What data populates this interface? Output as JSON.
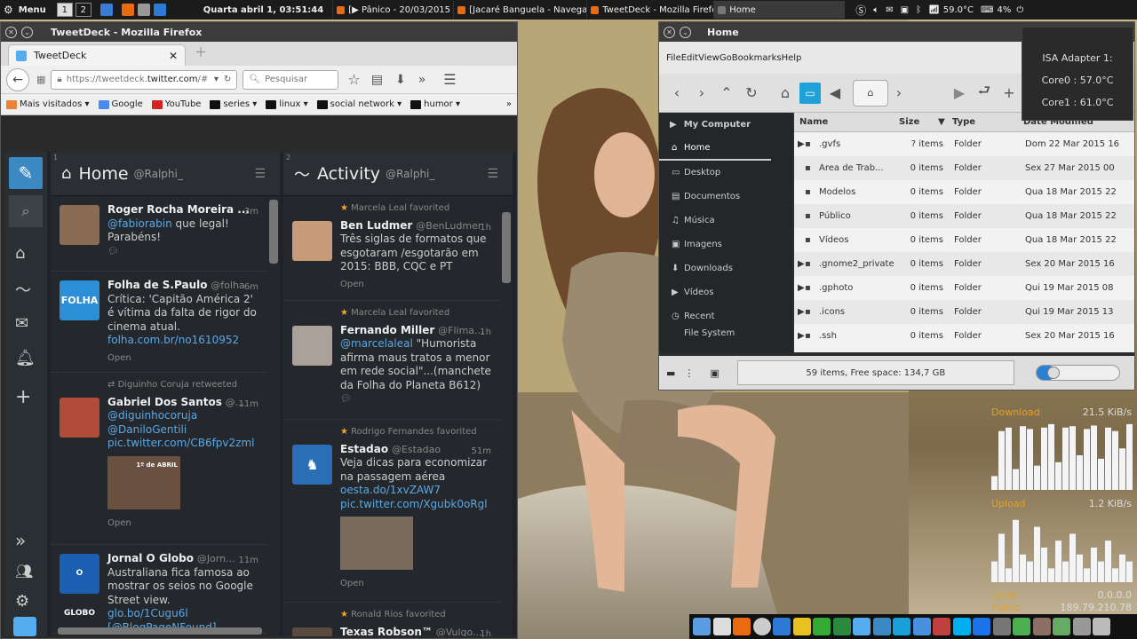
{
  "top_panel": {
    "menu_label": "Menu",
    "workspaces": [
      "1",
      "2"
    ],
    "clock": "Quarta abril  1, 03:51:44",
    "tasks": [
      "[▶ Pânico - 20/03/2015 ...",
      "[Jacaré Banguela - Navega...",
      "TweetDeck - Mozilla Firefox",
      "Home"
    ],
    "temperature": "59.0°C",
    "battery": "4%"
  },
  "firefox": {
    "window_title": "TweetDeck - Mozilla Firefox",
    "tab_label": "TweetDeck",
    "url_prefix": "https://tweetdeck.",
    "url_domain": "twitter.com",
    "url_suffix": "/#",
    "search_placeholder": "Pesquisar",
    "bookmarks": [
      {
        "label": "Mais visitados ▾",
        "color": "#e8843a"
      },
      {
        "label": "Google",
        "color": "#4a8af4"
      },
      {
        "label": "YouTube",
        "color": "#d32222"
      },
      {
        "label": "series ▾",
        "color": "#111"
      },
      {
        "label": "linux ▾",
        "color": "#111"
      },
      {
        "label": "social network ▾",
        "color": "#111"
      },
      {
        "label": "humor ▾",
        "color": "#111"
      }
    ],
    "bookmarks_more": "»"
  },
  "tweetdeck": {
    "columns": [
      {
        "number": "1",
        "title": "Home",
        "account": "@Ralphi_",
        "tweets": [
          {
            "name": "Roger Rocha Moreira ...",
            "handle": "",
            "time": "3m",
            "text_link": "@fabiorabin",
            "text": " que legal! Parabéns!",
            "extra": "",
            "open": ""
          },
          {
            "name": "Folha de S.Paulo",
            "handle": "@folha",
            "time": "6m",
            "text_link": "",
            "text": "Crítica: 'Capitão América 2' é vítima da falta de rigor do cinema atual.",
            "extra": "folha.com.br/no1610952",
            "open": "Open"
          },
          {
            "context": "Diguinho Coruja retweeted",
            "name": "Gabriel Dos Santos",
            "handle": "@...",
            "time": "11m",
            "lines": [
              "@diguinhocoruja",
              "@DaniloGentili",
              "pic.twitter.com/CB6fpv2zml"
            ],
            "open": "Open",
            "media_caption": "1º de ABRIL"
          },
          {
            "name": "Jornal O Globo",
            "handle": "@Jorn...",
            "time": "11m",
            "text": "Australiana fica famosa ao mostrar os seios no Google Street view.",
            "extra": "glo.bo/1Cugu6l",
            "extra2": "[@BlogPageNFound]"
          }
        ]
      },
      {
        "number": "2",
        "title": "Activity",
        "account": "@Ralphi_",
        "tweets": [
          {
            "context": "Marcela Leal favorited",
            "name": "Ben Ludmer",
            "handle": "@BenLudmer",
            "time": "1h",
            "text": "Três siglas de formatos que esgotaram /esgotarão em 2015: BBB, CQC e PT",
            "open": "Open"
          },
          {
            "context": "Marcela Leal favorited",
            "name": "Fernando Miller",
            "handle": "@Flima...",
            "time": "1h",
            "text_link": "@marcelaleal",
            "text": " \"Humorista afirma maus tratos a menor em rede social\"...(manchete da Folha do Planeta B612)"
          },
          {
            "context": "Rodrigo Fernandes favorited",
            "name": "Estadao",
            "handle": "@Estadao",
            "time": "51m",
            "text": "Veja dicas para economizar na passagem aérea ",
            "text_link": "oesta.do/1xvZAW7",
            "extra": "pic.twitter.com/Xgubk0oRgl",
            "open": "Open"
          },
          {
            "context": "Ronald Rios favorited",
            "name": "Texas Robson™",
            "handle": "@Vulgo...",
            "time": "1h"
          }
        ]
      }
    ]
  },
  "file_manager": {
    "window_title": "Home",
    "menu": [
      "File",
      "Edit",
      "View",
      "Go",
      "Bookmarks",
      "Help"
    ],
    "location": "⌂",
    "sidebar_header": "My Computer",
    "sidebar": [
      "Home",
      "Desktop",
      "Documentos",
      "Música",
      "Imagens",
      "Downloads",
      "Vídeos",
      "Recent",
      "File System"
    ],
    "columns": [
      "Name",
      "Size",
      "Type",
      "Date Modified"
    ],
    "rows": [
      {
        "name": ".gvfs",
        "size": "? items",
        "type": "Folder",
        "date": "Dom 22 Mar 2015 16"
      },
      {
        "name": "Área de Trab...",
        "size": "0 items",
        "type": "Folder",
        "date": "Sex 27 Mar 2015 00"
      },
      {
        "name": "Modelos",
        "size": "0 items",
        "type": "Folder",
        "date": "Qua 18 Mar 2015 22"
      },
      {
        "name": "Público",
        "size": "0 items",
        "type": "Folder",
        "date": "Qua 18 Mar 2015 22"
      },
      {
        "name": "Vídeos",
        "size": "0 items",
        "type": "Folder",
        "date": "Qua 18 Mar 2015 22"
      },
      {
        "name": ".gnome2_private",
        "size": "0 items",
        "type": "Folder",
        "date": "Sex 20 Mar 2015 16"
      },
      {
        "name": ".gphoto",
        "size": "0 items",
        "type": "Folder",
        "date": "Qui 19 Mar 2015 08"
      },
      {
        "name": ".icons",
        "size": "0 items",
        "type": "Folder",
        "date": "Qui 19 Mar 2015 13"
      },
      {
        "name": ".ssh",
        "size": "0 items",
        "type": "Folder",
        "date": "Sex 20 Mar 2015 16"
      }
    ],
    "status": "59 items, Free space: 134,7 GB"
  },
  "sensors": {
    "title": "ISA Adapter 1:",
    "core0": "Core0 : 57.0°C",
    "core1": "Core1 : 61.0°C"
  },
  "network": {
    "download_label": "Download",
    "download_rate": "21.5 KiB/s",
    "upload_label": "Upload",
    "upload_rate": "1.2 KiB/s",
    "local_label": "Local",
    "local_ip": "0.0.0.0",
    "public_label": "Public",
    "public_ip": "189.79.210.78",
    "download_history": [
      0.2,
      0.85,
      0.9,
      0.3,
      0.92,
      0.88,
      0.35,
      0.9,
      0.95,
      0.4,
      0.9,
      0.92,
      0.5,
      0.88,
      0.93,
      0.45,
      0.9,
      0.85,
      0.6,
      0.95
    ],
    "upload_history": [
      0.3,
      0.7,
      0.2,
      0.9,
      0.4,
      0.3,
      0.8,
      0.5,
      0.2,
      0.6,
      0.3,
      0.7,
      0.4,
      0.2,
      0.5,
      0.3,
      0.6,
      0.2,
      0.4,
      0.3
    ]
  }
}
